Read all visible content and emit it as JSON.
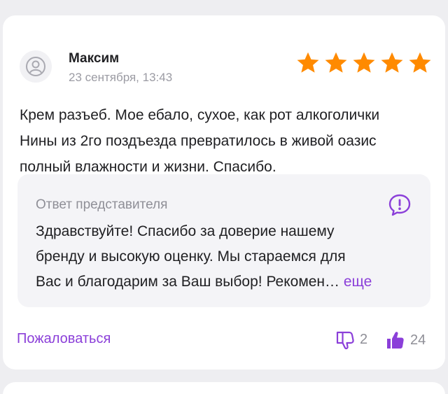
{
  "review": {
    "author": "Максим",
    "date": "23 сентября, 13:43",
    "rating": 5,
    "text_lines": [
      "Крем разъеб. Мое ебало, сухое, как рот алкоголички",
      "Нины из 2го поздъезда превратилось в живой оазис",
      "полный влажности и жизни. Спасибо."
    ]
  },
  "reply": {
    "title": "Ответ представителя",
    "text_lines": [
      "Здравствуйте! Спасибо за доверие нашему",
      "бренду и высокую оценку. Мы стараемся для",
      "Вас и благодарим за Ваш выбор! Рекомен…"
    ],
    "more_label": "еще"
  },
  "actions": {
    "complain_label": "Пожаловаться",
    "dislike_count": "2",
    "like_count": "24"
  },
  "colors": {
    "accent": "#8b3fd9",
    "star": "#ff8a00",
    "muted": "#8f8f97"
  },
  "icons": {
    "avatar": "user-avatar-icon",
    "star": "star-icon",
    "reply": "question-bubble-icon",
    "dislike": "thumbs-down-icon",
    "like": "thumbs-up-icon"
  }
}
